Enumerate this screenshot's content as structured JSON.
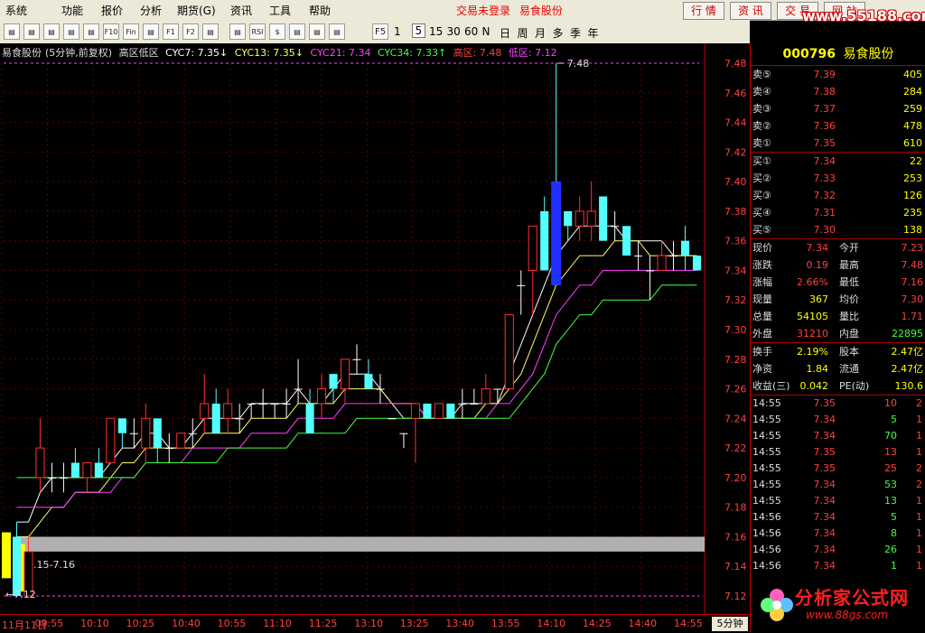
{
  "menubar": {
    "items": [
      "系统",
      "功能",
      "报价",
      "分析",
      "期货(G)",
      "资讯",
      "工具",
      "帮助"
    ],
    "status_login": "交易未登录",
    "status_stock": "易食股份",
    "buttons": [
      "行 情",
      "资 讯",
      "交 易",
      "网 站"
    ],
    "watermark": "www.55188.com"
  },
  "toolbar": {
    "icons": [
      "bar-chart-icon",
      "kline-icon",
      "candle-icon",
      "fund-icon",
      "minute-icon",
      "f10-icon",
      "fin-icon",
      "f-icon",
      "f1-icon",
      "f2-icon",
      "search-icon",
      "indicator-icon",
      "rsi-icon",
      "dollar-icon",
      "move-icon",
      "zoom-icon",
      "pen-icon"
    ],
    "icon_labels": [
      "",
      "",
      "",
      "",
      "",
      "F10",
      "Fin",
      "",
      "F1",
      "F2",
      "",
      "",
      "RSI",
      "$",
      "",
      "",
      ""
    ],
    "period_f5": "F5",
    "periods": [
      "1",
      "5",
      "15",
      "30",
      "60",
      "N",
      "日",
      "周",
      "月",
      "多",
      "季",
      "年"
    ]
  },
  "info_line": {
    "stock": "易食股份",
    "period": "(5分钟,前复权)",
    "indicator": "高区低区",
    "cyc7": "CYC7: 7.35↓",
    "cyc13": "CYC13: 7.35↓",
    "cyc21": "CYC21: 7.34",
    "cyc34": "CYC34: 7.33↑",
    "high_zone": "高区: 7.48",
    "low_zone": "低区: 7.12"
  },
  "chart_data": {
    "type": "candlestick",
    "ylim": [
      7.12,
      7.48
    ],
    "yticks": [
      7.48,
      7.46,
      7.44,
      7.42,
      7.4,
      7.38,
      7.36,
      7.34,
      7.32,
      7.3,
      7.28,
      7.26,
      7.24,
      7.22,
      7.2,
      7.18,
      7.16,
      7.14,
      7.12
    ],
    "xticks": [
      "11月11日",
      "09:55",
      "10:10",
      "10:25",
      "10:40",
      "10:55",
      "11:10",
      "11:25",
      "13:10",
      "13:25",
      "13:40",
      "13:55",
      "14:10",
      "14:25",
      "14:40",
      "14:55"
    ],
    "annotations": {
      "high_label": "7.48",
      "low_label": "7.12",
      "band_label": "7.15-7.16"
    },
    "candles": [
      {
        "o": 7.16,
        "h": 7.17,
        "l": 7.12,
        "c": 7.12
      },
      {
        "o": 7.12,
        "h": 7.16,
        "l": 7.12,
        "c": 7.15
      },
      {
        "o": 7.2,
        "h": 7.24,
        "l": 7.19,
        "c": 7.22
      },
      {
        "o": 7.2,
        "h": 7.21,
        "l": 7.19,
        "c": 7.2
      },
      {
        "o": 7.2,
        "h": 7.21,
        "l": 7.19,
        "c": 7.2
      },
      {
        "o": 7.21,
        "h": 7.22,
        "l": 7.2,
        "c": 7.2
      },
      {
        "o": 7.2,
        "h": 7.21,
        "l": 7.19,
        "c": 7.21
      },
      {
        "o": 7.21,
        "h": 7.22,
        "l": 7.2,
        "c": 7.2
      },
      {
        "o": 7.21,
        "h": 7.24,
        "l": 7.21,
        "c": 7.24
      },
      {
        "o": 7.24,
        "h": 7.24,
        "l": 7.22,
        "c": 7.23
      },
      {
        "o": 7.23,
        "h": 7.24,
        "l": 7.22,
        "c": 7.23
      },
      {
        "o": 7.22,
        "h": 7.25,
        "l": 7.21,
        "c": 7.24
      },
      {
        "o": 7.24,
        "h": 7.24,
        "l": 7.21,
        "c": 7.22
      },
      {
        "o": 7.22,
        "h": 7.23,
        "l": 7.21,
        "c": 7.22
      },
      {
        "o": 7.22,
        "h": 7.23,
        "l": 7.22,
        "c": 7.23
      },
      {
        "o": 7.23,
        "h": 7.24,
        "l": 7.22,
        "c": 7.23
      },
      {
        "o": 7.24,
        "h": 7.27,
        "l": 7.23,
        "c": 7.25
      },
      {
        "o": 7.25,
        "h": 7.26,
        "l": 7.23,
        "c": 7.23
      },
      {
        "o": 7.24,
        "h": 7.26,
        "l": 7.23,
        "c": 7.25
      },
      {
        "o": 7.24,
        "h": 7.25,
        "l": 7.23,
        "c": 7.24
      },
      {
        "o": 7.25,
        "h": 7.25,
        "l": 7.24,
        "c": 7.25
      },
      {
        "o": 7.25,
        "h": 7.26,
        "l": 7.24,
        "c": 7.25
      },
      {
        "o": 7.25,
        "h": 7.25,
        "l": 7.24,
        "c": 7.25
      },
      {
        "o": 7.25,
        "h": 7.26,
        "l": 7.24,
        "c": 7.25
      },
      {
        "o": 7.26,
        "h": 7.28,
        "l": 7.25,
        "c": 7.26
      },
      {
        "o": 7.25,
        "h": 7.26,
        "l": 7.23,
        "c": 7.23
      },
      {
        "o": 7.25,
        "h": 7.27,
        "l": 7.24,
        "c": 7.26
      },
      {
        "o": 7.27,
        "h": 7.27,
        "l": 7.25,
        "c": 7.26
      },
      {
        "o": 7.26,
        "h": 7.28,
        "l": 7.25,
        "c": 7.28
      },
      {
        "o": 7.28,
        "h": 7.29,
        "l": 7.27,
        "c": 7.28
      },
      {
        "o": 7.27,
        "h": 7.28,
        "l": 7.26,
        "c": 7.26
      },
      {
        "o": 7.26,
        "h": 7.27,
        "l": 7.25,
        "c": 7.26
      },
      {
        "o": 7.24,
        "h": 7.24,
        "l": 7.24,
        "c": 7.24
      },
      {
        "o": 7.23,
        "h": 7.23,
        "l": 7.22,
        "c": 7.23
      },
      {
        "o": 7.24,
        "h": 7.25,
        "l": 7.21,
        "c": 7.25
      },
      {
        "o": 7.25,
        "h": 7.25,
        "l": 7.24,
        "c": 7.24
      },
      {
        "o": 7.24,
        "h": 7.25,
        "l": 7.24,
        "c": 7.25
      },
      {
        "o": 7.25,
        "h": 7.25,
        "l": 7.24,
        "c": 7.24
      },
      {
        "o": 7.25,
        "h": 7.26,
        "l": 7.24,
        "c": 7.25
      },
      {
        "o": 7.25,
        "h": 7.26,
        "l": 7.25,
        "c": 7.25
      },
      {
        "o": 7.25,
        "h": 7.27,
        "l": 7.25,
        "c": 7.26
      },
      {
        "o": 7.26,
        "h": 7.26,
        "l": 7.25,
        "c": 7.26
      },
      {
        "o": 7.26,
        "h": 7.31,
        "l": 7.26,
        "c": 7.31
      },
      {
        "o": 7.33,
        "h": 7.34,
        "l": 7.31,
        "c": 7.33
      },
      {
        "o": 7.34,
        "h": 7.37,
        "l": 7.31,
        "c": 7.37
      },
      {
        "o": 7.38,
        "h": 7.39,
        "l": 7.34,
        "c": 7.34
      },
      {
        "o": 7.4,
        "h": 7.48,
        "l": 7.33,
        "c": 7.33
      },
      {
        "o": 7.38,
        "h": 7.38,
        "l": 7.36,
        "c": 7.37
      },
      {
        "o": 7.37,
        "h": 7.39,
        "l": 7.36,
        "c": 7.38
      },
      {
        "o": 7.37,
        "h": 7.4,
        "l": 7.36,
        "c": 7.38
      },
      {
        "o": 7.39,
        "h": 7.39,
        "l": 7.36,
        "c": 7.36
      },
      {
        "o": 7.37,
        "h": 7.38,
        "l": 7.36,
        "c": 7.37
      },
      {
        "o": 7.37,
        "h": 7.37,
        "l": 7.35,
        "c": 7.35
      },
      {
        "o": 7.35,
        "h": 7.36,
        "l": 7.34,
        "c": 7.35
      },
      {
        "o": 7.34,
        "h": 7.35,
        "l": 7.32,
        "c": 7.34
      },
      {
        "o": 7.34,
        "h": 7.36,
        "l": 7.34,
        "c": 7.35
      },
      {
        "o": 7.35,
        "h": 7.36,
        "l": 7.34,
        "c": 7.35
      },
      {
        "o": 7.36,
        "h": 7.37,
        "l": 7.34,
        "c": 7.35
      },
      {
        "o": 7.35,
        "h": 7.35,
        "l": 7.34,
        "c": 7.34
      }
    ],
    "series": [
      {
        "name": "CYC7",
        "color": "#ffffff",
        "values": [
          7.17,
          7.17,
          7.19,
          7.2,
          7.2,
          7.2,
          7.2,
          7.2,
          7.21,
          7.22,
          7.22,
          7.23,
          7.23,
          7.22,
          7.22,
          7.23,
          7.24,
          7.24,
          7.24,
          7.24,
          7.25,
          7.25,
          7.25,
          7.25,
          7.26,
          7.25,
          7.25,
          7.26,
          7.27,
          7.27,
          7.27,
          7.26,
          7.25,
          7.24,
          7.24,
          7.24,
          7.24,
          7.24,
          7.25,
          7.25,
          7.25,
          7.25,
          7.27,
          7.29,
          7.31,
          7.33,
          7.35,
          7.36,
          7.37,
          7.37,
          7.37,
          7.37,
          7.36,
          7.36,
          7.36,
          7.36,
          7.35,
          7.35,
          7.35
        ]
      },
      {
        "name": "CYC13",
        "color": "#ffff60",
        "values": [
          7.16,
          7.16,
          7.17,
          7.18,
          7.18,
          7.19,
          7.19,
          7.19,
          7.2,
          7.21,
          7.21,
          7.22,
          7.22,
          7.22,
          7.22,
          7.22,
          7.23,
          7.23,
          7.23,
          7.23,
          7.24,
          7.24,
          7.24,
          7.24,
          7.25,
          7.25,
          7.25,
          7.25,
          7.26,
          7.26,
          7.26,
          7.26,
          7.25,
          7.25,
          7.25,
          7.24,
          7.24,
          7.24,
          7.24,
          7.24,
          7.25,
          7.25,
          7.26,
          7.27,
          7.29,
          7.31,
          7.33,
          7.34,
          7.35,
          7.35,
          7.35,
          7.36,
          7.36,
          7.36,
          7.35,
          7.35,
          7.35,
          7.35,
          7.35
        ]
      },
      {
        "name": "CYC21",
        "color": "#ff40ff",
        "values": [
          7.18,
          7.18,
          7.18,
          7.18,
          7.18,
          7.19,
          7.19,
          7.19,
          7.19,
          7.2,
          7.2,
          7.21,
          7.21,
          7.21,
          7.21,
          7.22,
          7.22,
          7.22,
          7.22,
          7.22,
          7.23,
          7.23,
          7.23,
          7.23,
          7.24,
          7.24,
          7.24,
          7.24,
          7.25,
          7.25,
          7.25,
          7.25,
          7.25,
          7.25,
          7.25,
          7.24,
          7.24,
          7.24,
          7.24,
          7.24,
          7.24,
          7.25,
          7.25,
          7.26,
          7.27,
          7.29,
          7.31,
          7.32,
          7.33,
          7.33,
          7.34,
          7.34,
          7.34,
          7.34,
          7.34,
          7.34,
          7.34,
          7.34,
          7.34
        ]
      },
      {
        "name": "CYC34",
        "color": "#40ff40",
        "values": [
          7.2,
          7.2,
          7.2,
          7.2,
          7.2,
          7.2,
          7.2,
          7.2,
          7.2,
          7.2,
          7.2,
          7.21,
          7.21,
          7.21,
          7.21,
          7.21,
          7.21,
          7.21,
          7.22,
          7.22,
          7.22,
          7.22,
          7.22,
          7.22,
          7.23,
          7.23,
          7.23,
          7.23,
          7.23,
          7.24,
          7.24,
          7.24,
          7.24,
          7.24,
          7.24,
          7.24,
          7.24,
          7.24,
          7.24,
          7.24,
          7.24,
          7.24,
          7.24,
          7.25,
          7.26,
          7.27,
          7.29,
          7.3,
          7.31,
          7.31,
          7.32,
          7.32,
          7.32,
          7.32,
          7.32,
          7.33,
          7.33,
          7.33,
          7.33
        ]
      }
    ]
  },
  "rightpanel": {
    "code": "000796",
    "name": "易食股份",
    "asks": [
      {
        "label": "卖⑤",
        "price": "7.39",
        "vol": "405"
      },
      {
        "label": "卖④",
        "price": "7.38",
        "vol": "284"
      },
      {
        "label": "卖③",
        "price": "7.37",
        "vol": "259"
      },
      {
        "label": "卖②",
        "price": "7.36",
        "vol": "478"
      },
      {
        "label": "卖①",
        "price": "7.35",
        "vol": "610"
      }
    ],
    "bids": [
      {
        "label": "买①",
        "price": "7.34",
        "vol": "22"
      },
      {
        "label": "买②",
        "price": "7.33",
        "vol": "253"
      },
      {
        "label": "买③",
        "price": "7.32",
        "vol": "126"
      },
      {
        "label": "买④",
        "price": "7.31",
        "vol": "235"
      },
      {
        "label": "买⑤",
        "price": "7.30",
        "vol": "138"
      }
    ],
    "stats": [
      {
        "l1": "现价",
        "v1": "7.34",
        "l2": "今开",
        "v2": "7.23",
        "c1": "#ff4040",
        "c2": "#ff4040"
      },
      {
        "l1": "涨跌",
        "v1": "0.19",
        "l2": "最高",
        "v2": "7.48",
        "c1": "#ff4040",
        "c2": "#ff4040"
      },
      {
        "l1": "涨幅",
        "v1": "2.66%",
        "l2": "最低",
        "v2": "7.16",
        "c1": "#ff4040",
        "c2": "#ff4040"
      },
      {
        "l1": "现量",
        "v1": "367",
        "l2": "均价",
        "v2": "7.30",
        "c1": "#ffff00",
        "c2": "#ff4040"
      },
      {
        "l1": "总量",
        "v1": "54105",
        "l2": "量比",
        "v2": "1.71",
        "c1": "#ffff00",
        "c2": "#ff4040"
      },
      {
        "l1": "外盘",
        "v1": "31210",
        "l2": "内盘",
        "v2": "22895",
        "c1": "#ff4040",
        "c2": "#40ff40"
      }
    ],
    "stats2": [
      {
        "l1": "换手",
        "v1": "2.19%",
        "l2": "股本",
        "v2": "2.47亿",
        "c1": "#ffff00",
        "c2": "#ffff00"
      },
      {
        "l1": "净资",
        "v1": "1.84",
        "l2": "流通",
        "v2": "2.47亿",
        "c1": "#ffff00",
        "c2": "#ffff00"
      },
      {
        "l1": "收益(三)",
        "v1": "0.042",
        "l2": "PE(动)",
        "v2": "130.6",
        "c1": "#ffff00",
        "c2": "#ffff00"
      }
    ],
    "ticks": [
      {
        "t": "14:55",
        "p": "7.35",
        "v": "10",
        "n": "2",
        "vc": "#ff4040"
      },
      {
        "t": "14:55",
        "p": "7.34",
        "v": "5",
        "n": "1",
        "vc": "#40ff40"
      },
      {
        "t": "14:55",
        "p": "7.34",
        "v": "70",
        "n": "1",
        "vc": "#40ff40"
      },
      {
        "t": "14:55",
        "p": "7.35",
        "v": "13",
        "n": "1",
        "vc": "#ff4040"
      },
      {
        "t": "14:55",
        "p": "7.35",
        "v": "25",
        "n": "2",
        "vc": "#ff4040"
      },
      {
        "t": "14:55",
        "p": "7.34",
        "v": "53",
        "n": "2",
        "vc": "#40ff40"
      },
      {
        "t": "14:55",
        "p": "7.34",
        "v": "13",
        "n": "1",
        "vc": "#40ff40"
      },
      {
        "t": "14:56",
        "p": "7.34",
        "v": "5",
        "n": "1",
        "vc": "#40ff40"
      },
      {
        "t": "14:56",
        "p": "7.34",
        "v": "8",
        "n": "1",
        "vc": "#40ff40"
      },
      {
        "t": "14:56",
        "p": "7.34",
        "v": "26",
        "n": "1",
        "vc": "#40ff40"
      },
      {
        "t": "14:56",
        "p": "7.34",
        "v": "1",
        "n": "1",
        "vc": "#40ff40"
      }
    ]
  },
  "bottombar": {
    "period_label": "5分钟"
  },
  "logo": {
    "text": "分析家公式网",
    "url": "www.88gs.com"
  }
}
